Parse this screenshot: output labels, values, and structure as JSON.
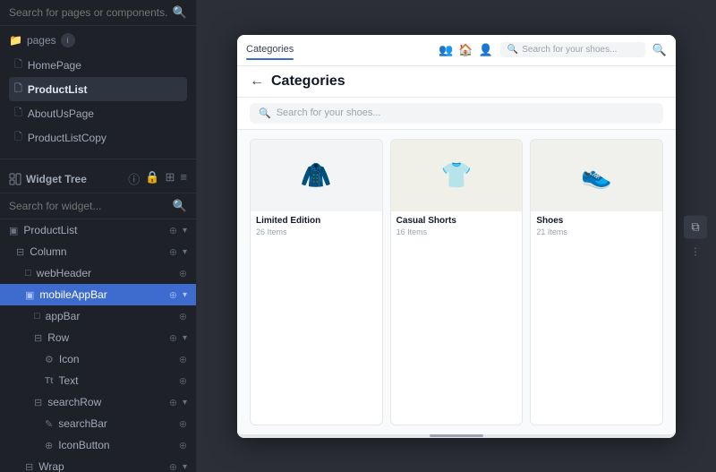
{
  "sidebar": {
    "search_top_placeholder": "Search for pages or components...",
    "pages_label": "pages",
    "pages_info": "i",
    "page_items": [
      {
        "id": "homepage",
        "label": "HomePage",
        "icon": "🗋",
        "active": false
      },
      {
        "id": "productlist",
        "label": "ProductList",
        "icon": "🗋",
        "active": true
      },
      {
        "id": "aboutuspage",
        "label": "AboutUsPage",
        "icon": "🗋",
        "active": false
      },
      {
        "id": "productlistcopy",
        "label": "ProductListCopy",
        "icon": "🗋",
        "active": false
      }
    ],
    "widget_tree_label": "Widget Tree",
    "widget_search_placeholder": "Search for widget...",
    "tree_items": [
      {
        "id": "productlist",
        "label": "ProductList",
        "icon": "▣",
        "indent": 0,
        "expandable": true
      },
      {
        "id": "column",
        "label": "Column",
        "icon": "⊟",
        "indent": 1,
        "expandable": true
      },
      {
        "id": "webheader",
        "label": "webHeader",
        "icon": "□",
        "indent": 2,
        "expandable": false
      },
      {
        "id": "mobileappbar",
        "label": "mobileAppBar",
        "icon": "▣",
        "indent": 2,
        "active": true,
        "expandable": true
      },
      {
        "id": "appbar",
        "label": "appBar",
        "icon": "□",
        "indent": 3,
        "expandable": false
      },
      {
        "id": "row",
        "label": "Row",
        "icon": "⊟",
        "indent": 3,
        "expandable": true
      },
      {
        "id": "icon",
        "label": "Icon",
        "icon": "⚙",
        "indent": 4,
        "expandable": false
      },
      {
        "id": "text",
        "label": "Text",
        "icon": "Tt",
        "indent": 4,
        "expandable": false
      },
      {
        "id": "searchrow",
        "label": "searchRow",
        "icon": "⊟",
        "indent": 3,
        "expandable": true
      },
      {
        "id": "searchbar",
        "label": "searchBar",
        "icon": "✎",
        "indent": 4,
        "expandable": false
      },
      {
        "id": "iconbutton",
        "label": "IconButton",
        "icon": "⊕",
        "indent": 4,
        "expandable": false
      },
      {
        "id": "wrap",
        "label": "Wrap",
        "icon": "⊟",
        "indent": 2,
        "expandable": true
      }
    ]
  },
  "device": {
    "topbar": {
      "tab_label": "Categories",
      "indicator_color": "#3d6bce",
      "nav_icons": [
        "👥",
        "🏠",
        "👤"
      ],
      "search_placeholder": "Search for your shoes..."
    },
    "appbar_title": "Categories",
    "search_placeholder": "Search for your shoes...",
    "products": [
      {
        "id": "limited-edition",
        "name": "Limited Edition",
        "count": "26 Items",
        "emoji": "🧥"
      },
      {
        "id": "casual-shorts",
        "name": "Casual Shorts",
        "count": "16 Items",
        "emoji": "👕"
      },
      {
        "id": "shoes",
        "name": "Shoes",
        "count": "21 Items",
        "emoji": "👟"
      }
    ]
  }
}
